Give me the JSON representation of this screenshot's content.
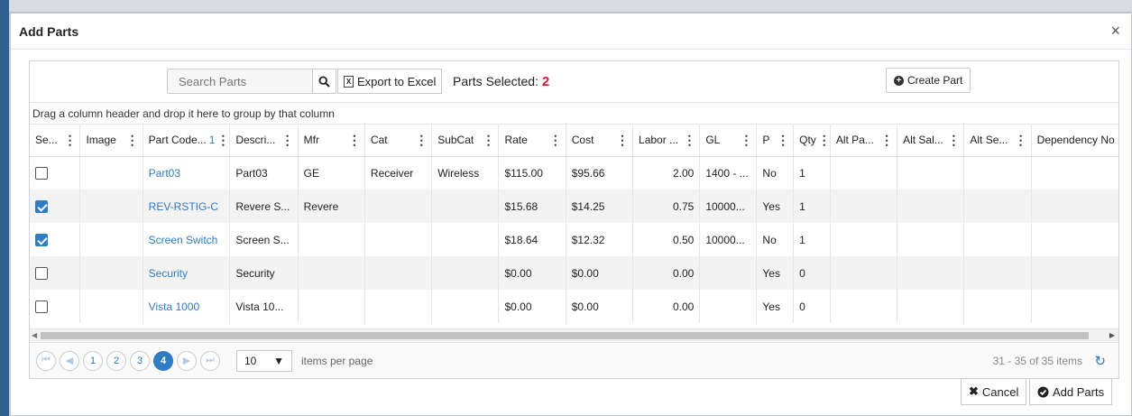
{
  "dialog": {
    "title": "Add Parts",
    "close_glyph": "×"
  },
  "toolbar": {
    "search_placeholder": "Search Parts",
    "export_label": "Export to Excel",
    "parts_selected_label": "Parts Selected:",
    "parts_selected_count": "2",
    "create_label": "Create Part"
  },
  "group_hint": "Drag a column header and drop it here to group by that column",
  "columns": [
    "Se...",
    "Image",
    "Part Code...",
    "Descri...",
    "Mfr",
    "Cat",
    "SubCat",
    "Rate",
    "Cost",
    "Labor ...",
    "GL",
    "P",
    "Qty",
    "Alt Pa...",
    "Alt Sal...",
    "Alt Se...",
    "Dependency No"
  ],
  "sort_indicator": "1",
  "rows": [
    {
      "selected": false,
      "image": "",
      "part_code": "Part03",
      "description": "Part03",
      "mfr": "GE",
      "cat": "Receiver",
      "subcat": "Wireless",
      "rate": "$115.00",
      "cost": "$95.66",
      "labor": "2.00",
      "gl": "1400 - ...",
      "p": "No",
      "qty": "1"
    },
    {
      "selected": true,
      "image": "",
      "part_code": "REV-RSTIG-C",
      "description": "Revere S...",
      "mfr": "Revere",
      "cat": "",
      "subcat": "",
      "rate": "$15.68",
      "cost": "$14.25",
      "labor": "0.75",
      "gl": "10000...",
      "p": "Yes",
      "qty": "1"
    },
    {
      "selected": true,
      "image": "",
      "part_code": "Screen Switch",
      "description": "Screen S...",
      "mfr": "",
      "cat": "",
      "subcat": "",
      "rate": "$18.64",
      "cost": "$12.32",
      "labor": "0.50",
      "gl": "10000...",
      "p": "No",
      "qty": "1"
    },
    {
      "selected": false,
      "image": "",
      "part_code": "Security",
      "description": "Security",
      "mfr": "",
      "cat": "",
      "subcat": "",
      "rate": "$0.00",
      "cost": "$0.00",
      "labor": "0.00",
      "gl": "",
      "p": "Yes",
      "qty": "0"
    },
    {
      "selected": false,
      "image": "",
      "part_code": "Vista 1000",
      "description": "Vista 10...",
      "mfr": "",
      "cat": "",
      "subcat": "",
      "rate": "$0.00",
      "cost": "$0.00",
      "labor": "0.00",
      "gl": "",
      "p": "Yes",
      "qty": "0"
    }
  ],
  "pager": {
    "pages": [
      "1",
      "2",
      "3",
      "4"
    ],
    "current_page": "4",
    "page_size": "10",
    "items_per_page_label": "items per page",
    "info": "31 - 35 of 35 items"
  },
  "footer": {
    "cancel_label": "Cancel",
    "add_label": "Add Parts"
  },
  "colors": {
    "accent": "#2f7cc2",
    "count": "#d3192e"
  },
  "icons": [
    "search-icon",
    "excel-icon",
    "plus-circle-icon",
    "first-page-icon",
    "prev-page-icon",
    "next-page-icon",
    "last-page-icon",
    "refresh-icon",
    "close-icon",
    "times-icon",
    "check-circle-icon"
  ]
}
